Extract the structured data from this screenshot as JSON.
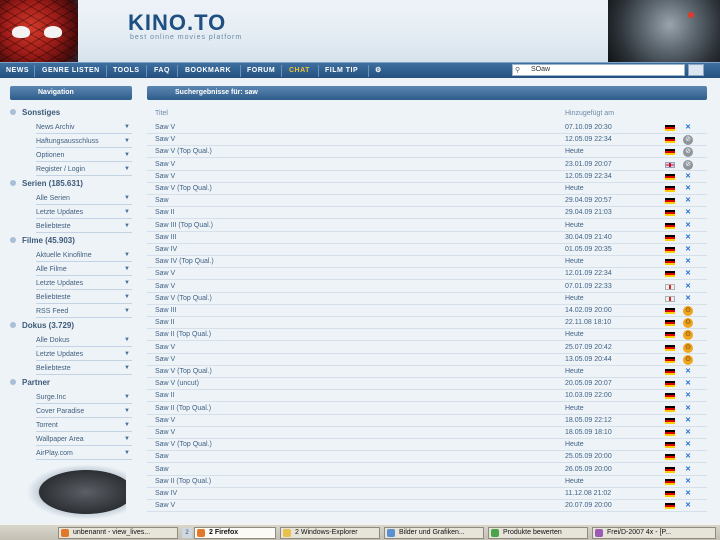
{
  "header": {
    "logo": "KINO.TO",
    "tagline": "best online movies platform"
  },
  "nav": {
    "items": [
      "NEWS",
      "GENRE LISTEN",
      "TOOLS",
      "FAQ",
      "BOOKMARK",
      "FORUM",
      "CHAT",
      "FILM TIP"
    ],
    "active": "CHAT",
    "search_value": "SOaw"
  },
  "sidebar": {
    "title": "Navigation",
    "categories": [
      {
        "label": "Sonstiges",
        "items": [
          "News Archiv",
          "Haftungsausschluss",
          "Optionen",
          "Register / Login"
        ]
      },
      {
        "label": "Serien (185.631)",
        "items": [
          "Alle Serien",
          "Letzte Updates",
          "Beliebteste"
        ]
      },
      {
        "label": "Filme (45.903)",
        "items": [
          "Aktuelle Kinofilme",
          "Alle Filme",
          "Letzte Updates",
          "Beliebteste",
          "RSS Feed"
        ]
      },
      {
        "label": "Dokus (3.729)",
        "items": [
          "Alle Dokus",
          "Letzte Updates",
          "Beliebteste"
        ]
      },
      {
        "label": "Partner",
        "items": [
          "Surge.Inc",
          "Cover Paradise",
          "Torrent",
          "Wallpaper Area",
          "AirPlay.com"
        ]
      }
    ]
  },
  "main": {
    "title": "Suchergebnisse für: saw",
    "col_title": "Titel",
    "col_date": "Hinzugefügt am",
    "rows": [
      {
        "title": "Saw V",
        "date": "07.10.09 20:30",
        "flag": "de",
        "host": "butterfly"
      },
      {
        "title": "Saw V",
        "date": "12.05.09 22:34",
        "flag": "de",
        "host": "grey"
      },
      {
        "title": "Saw V (Top Qual.)",
        "date": "Heute",
        "flag": "de",
        "host": "grey"
      },
      {
        "title": "Saw V",
        "date": "23.01.09 20:07",
        "flag": "uk",
        "host": "grey"
      },
      {
        "title": "Saw V",
        "date": "12.05.09 22:34",
        "flag": "de",
        "host": "butterfly"
      },
      {
        "title": "Saw V (Top Qual.)",
        "date": "Heute",
        "flag": "de",
        "host": "butterfly"
      },
      {
        "title": "Saw",
        "date": "29.04.09 20:57",
        "flag": "de",
        "host": "butterfly"
      },
      {
        "title": "Saw II",
        "date": "29.04.09 21:03",
        "flag": "de",
        "host": "butterfly"
      },
      {
        "title": "Saw III (Top Qual.)",
        "date": "Heute",
        "flag": "de",
        "host": "butterfly"
      },
      {
        "title": "Saw III",
        "date": "30.04.09 21:40",
        "flag": "de",
        "host": "butterfly"
      },
      {
        "title": "Saw IV",
        "date": "01.05.09 20:35",
        "flag": "de",
        "host": "butterfly"
      },
      {
        "title": "Saw IV (Top Qual.)",
        "date": "Heute",
        "flag": "de",
        "host": "butterfly"
      },
      {
        "title": "Saw V",
        "date": "12.01.09 22:34",
        "flag": "de",
        "host": "butterfly"
      },
      {
        "title": "Saw V",
        "date": "07.01.09 22:33",
        "flag": "en",
        "host": "butterfly"
      },
      {
        "title": "Saw V (Top Qual.)",
        "date": "Heute",
        "flag": "en",
        "host": "butterfly"
      },
      {
        "title": "Saw III",
        "date": "14.02.09 20:00",
        "flag": "de",
        "host": "orange"
      },
      {
        "title": "Saw II",
        "date": "22.11.08 18:10",
        "flag": "de",
        "host": "orange"
      },
      {
        "title": "Saw II (Top Qual.)",
        "date": "Heute",
        "flag": "de",
        "host": "orange"
      },
      {
        "title": "Saw V",
        "date": "25.07.09 20:42",
        "flag": "de",
        "host": "orange"
      },
      {
        "title": "Saw V",
        "date": "13.05.09 20:44",
        "flag": "de",
        "host": "orange"
      },
      {
        "title": "Saw V (Top Qual.)",
        "date": "Heute",
        "flag": "de",
        "host": "butterfly"
      },
      {
        "title": "Saw V (uncut)",
        "date": "20.05.09 20:07",
        "flag": "de",
        "host": "butterfly"
      },
      {
        "title": "Saw II",
        "date": "10.03.09 22:00",
        "flag": "de",
        "host": "butterfly"
      },
      {
        "title": "Saw II (Top Qual.)",
        "date": "Heute",
        "flag": "de",
        "host": "butterfly"
      },
      {
        "title": "Saw V",
        "date": "18.05.09 22:12",
        "flag": "de",
        "host": "butterfly"
      },
      {
        "title": "Saw V",
        "date": "18.05.09 18:10",
        "flag": "de",
        "host": "butterfly"
      },
      {
        "title": "Saw V (Top Qual.)",
        "date": "Heute",
        "flag": "de",
        "host": "butterfly"
      },
      {
        "title": "Saw",
        "date": "25.05.09 20:00",
        "flag": "de",
        "host": "butterfly"
      },
      {
        "title": "Saw",
        "date": "26.05.09 20:00",
        "flag": "de",
        "host": "butterfly"
      },
      {
        "title": "Saw II (Top Qual.)",
        "date": "Heute",
        "flag": "de",
        "host": "butterfly"
      },
      {
        "title": "Saw IV",
        "date": "11.12.08 21:02",
        "flag": "de",
        "host": "butterfly"
      },
      {
        "title": "Saw V",
        "date": "20.07.09 20:00",
        "flag": "de",
        "host": "butterfly"
      }
    ]
  },
  "taskbar": {
    "items": [
      "unbenannt - view_lives...",
      "2 Firefox",
      "",
      "2 Windows-Explorer",
      "Bilder und Grafiken...",
      "Produkte bewerten",
      "Frei/D-2007 4x - [P..."
    ],
    "firefox_count": "2"
  }
}
